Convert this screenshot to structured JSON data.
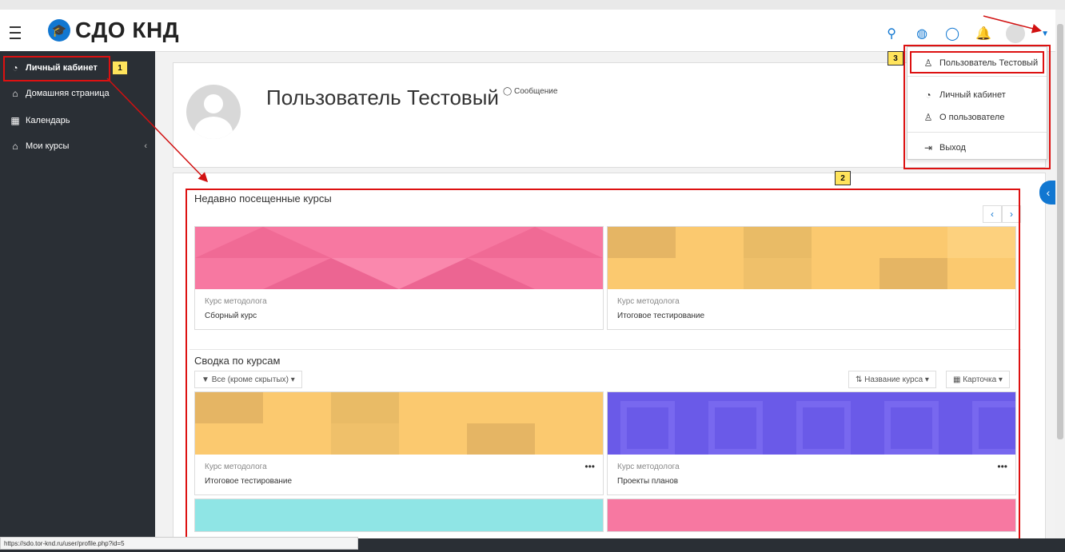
{
  "navbar": {
    "brand": "СДО КНД"
  },
  "sidebar": {
    "items": [
      {
        "label": "Личный кабинет",
        "icon": "dashboard-icon"
      },
      {
        "label": "Домашняя страница",
        "icon": "home-icon"
      },
      {
        "label": "Календарь",
        "icon": "calendar-icon"
      },
      {
        "label": "Мои курсы",
        "icon": "graduation-cap-icon"
      }
    ]
  },
  "profile": {
    "name": "Пользователь Тестовый",
    "message_link": "Сообщение"
  },
  "recent": {
    "title": "Недавно посещенные курсы",
    "courses": [
      {
        "category": "Курс методолога",
        "name": "Сборный курс",
        "color": "#f778a1"
      },
      {
        "category": "Курс методолога",
        "name": "Итоговое тестирование",
        "color": "#fbc96f"
      }
    ]
  },
  "overview": {
    "title": "Сводка по курсам",
    "filter": "Все (кроме скрытых)",
    "sort": "Название курса",
    "view": "Карточка",
    "courses": [
      {
        "category": "Курс методолога",
        "name": "Итоговое тестирование",
        "color": "#fbc96f"
      },
      {
        "category": "Курс методолога",
        "name": "Проекты планов",
        "color": "#6a5ae8"
      }
    ]
  },
  "user_menu": {
    "items": [
      {
        "label": "Пользователь Тестовый",
        "icon": "user-icon"
      },
      {
        "label": "Личный кабинет",
        "icon": "dashboard-icon"
      },
      {
        "label": "О пользователе",
        "icon": "user-icon"
      },
      {
        "label": "Выход",
        "icon": "logout-icon"
      }
    ]
  },
  "annotations": {
    "n1": "1",
    "n2": "2",
    "n3": "3"
  },
  "status_url": "https://sdo.tor-knd.ru/user/profile.php?id=5",
  "colors": {
    "accent": "#1177d1",
    "sidebar": "#2a2f35",
    "annotation_red": "#d11111",
    "badge_yellow": "#ffe45c"
  }
}
